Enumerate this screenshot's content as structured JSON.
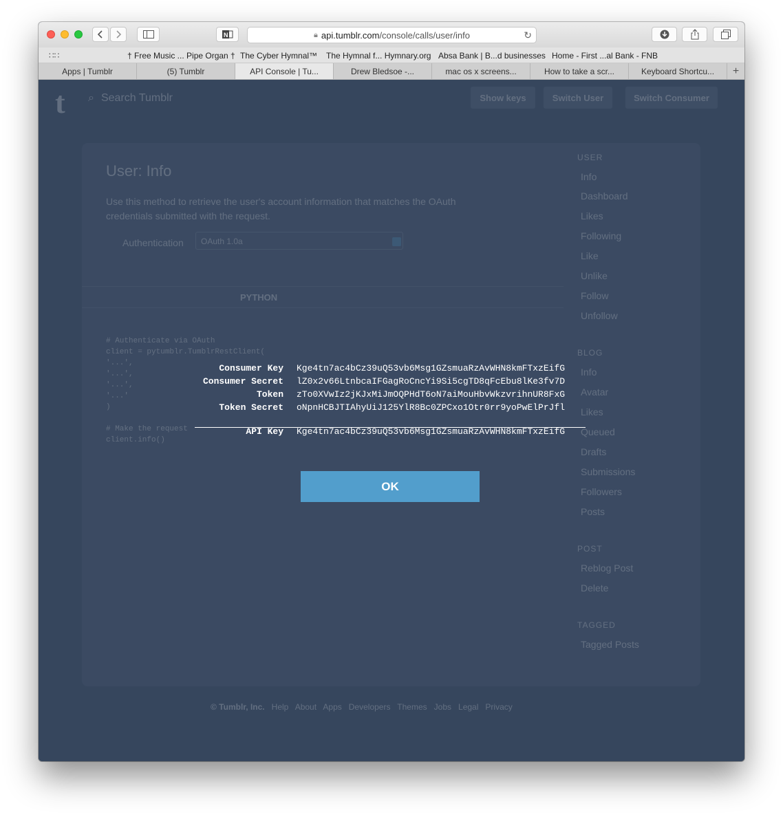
{
  "browser": {
    "url_domain": "api.tumblr.com",
    "url_path": "/console/calls/user/info",
    "bookmarks": [
      "† Free Music ... Pipe Organ †",
      "The Cyber Hymnal™",
      "The Hymnal f... Hymnary.org",
      "Absa Bank | B...d businesses",
      "Home - First ...al Bank - FNB"
    ],
    "tabs": [
      "Apps | Tumblr",
      "(5) Tumblr",
      "API Console | Tu...",
      "Drew Bledsoe -...",
      "mac os x screens...",
      "How to take a scr...",
      "Keyboard Shortcu..."
    ],
    "active_tab_index": 2,
    "new_tab_label": "+"
  },
  "header": {
    "logo": "t",
    "search_placeholder": "Search Tumblr",
    "buttons": [
      "Show keys",
      "Switch User",
      "Switch Consumer"
    ]
  },
  "page": {
    "title": "User: Info",
    "description": "Use this method to retrieve the user's account information that matches the OAuth credentials submitted with the request.",
    "auth_label": "Authentication",
    "auth_value": "OAuth 1.0a",
    "selected_language": "PYTHON",
    "code_lines": [
      "# Authenticate via OAuth",
      "client = pytumblr.TumblrRestClient(",
      "  '...',",
      "  '...',",
      "  '...',",
      "  '...'",
      ")",
      "",
      "# Make the request",
      "client.info()"
    ]
  },
  "sidebar": {
    "sections": [
      {
        "heading": "USER",
        "items": [
          "Info",
          "Dashboard",
          "Likes",
          "Following",
          "Like",
          "Unlike",
          "Follow",
          "Unfollow"
        ]
      },
      {
        "heading": "BLOG",
        "items": [
          "Info",
          "Avatar",
          "Likes",
          "Queued",
          "Drafts",
          "Submissions",
          "Followers",
          "Posts"
        ]
      },
      {
        "heading": "POST",
        "items": [
          "Reblog Post",
          "Delete"
        ]
      },
      {
        "heading": "TAGGED",
        "items": [
          "Tagged Posts"
        ]
      }
    ]
  },
  "footer": {
    "links": [
      "© Tumblr, Inc.",
      "Help",
      "About",
      "Apps",
      "Developers",
      "Themes",
      "Jobs",
      "Legal",
      "Privacy"
    ]
  },
  "dialog": {
    "rows": [
      {
        "label": "Consumer Key",
        "value": "Kge4tn7ac4bCz39uQ53vb6Msg1GZsmuaRzAvWHN8kmFTxzEifG"
      },
      {
        "label": "Consumer Secret",
        "value": "lZ0x2v66LtnbcaIFGagRoCncYi9Si5cgTD8qFcEbu8lKe3fv7D"
      },
      {
        "label": "Token",
        "value": "zTo0XVwIz2jKJxMiJmOQPHdT6oN7aiMouHbvWkzvrihnUR8FxG"
      },
      {
        "label": "Token Secret",
        "value": "oNpnHCBJTIAhyUiJ125YlR8Bc0ZPCxo1Otr0rr9yoPwElPrJfl"
      }
    ],
    "api_key": {
      "label": "API Key",
      "value": "Kge4tn7ac4bCz39uQ53vb6Msg1GZsmuaRzAvWHN8kmFTxzEifG"
    },
    "ok_label": "OK"
  }
}
